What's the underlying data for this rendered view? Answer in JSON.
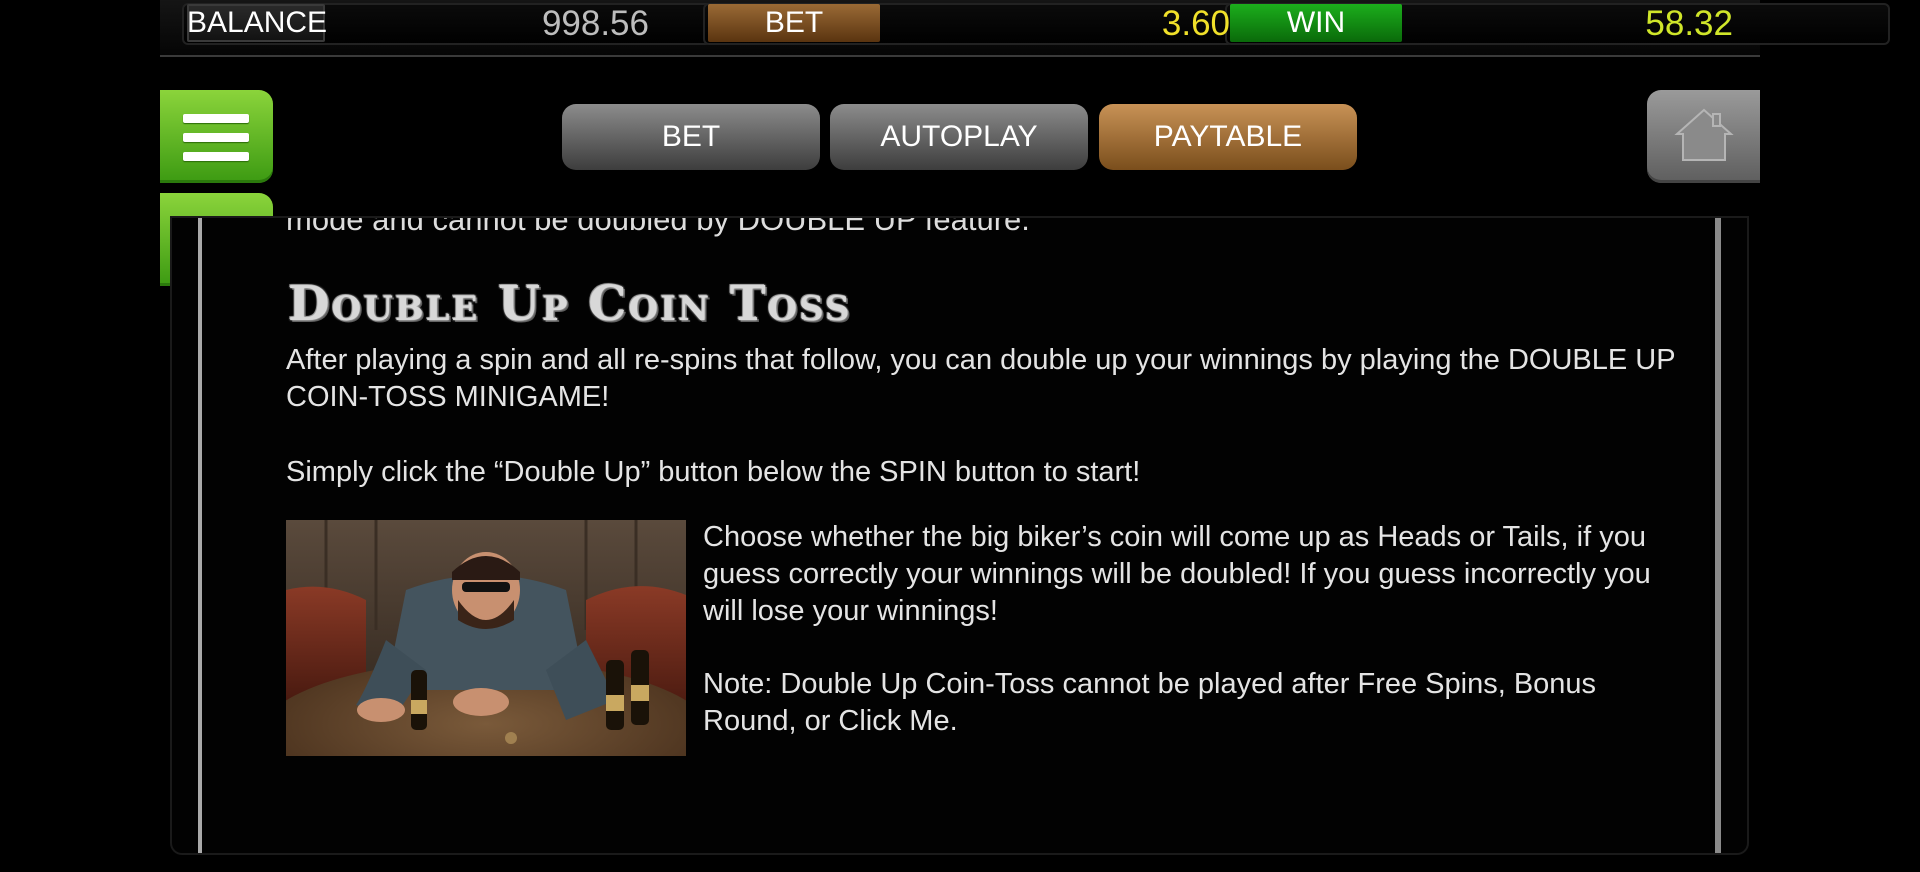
{
  "statusbar": {
    "balance_label": "BALANCE",
    "balance_value": "998.56",
    "bet_label": "BET",
    "bet_value": "3.60",
    "win_label": "WIN",
    "win_value": "58.32"
  },
  "tabs": {
    "bet": "BET",
    "autoplay": "AUTOPLAY",
    "paytable": "PAYTABLE",
    "active": "PAYTABLE"
  },
  "icons": {
    "menu": "hamburger-menu-icon",
    "back": "arrow-left-icon",
    "home": "home-icon"
  },
  "colors": {
    "green_button": "#5cb824",
    "paytable_tab": "#b07a3e",
    "win_label": "#17a017",
    "bet_label": "#8a5a28",
    "bet_value": "#f0e02a",
    "win_value": "#d0e62a"
  },
  "content": {
    "cut_text": "mode and cannot be doubled by DOUBLE UP feature.",
    "heading": "Double Up Coin Toss",
    "para1": "After playing a spin and all re-spins that follow, you can double up your winnings by playing the DOUBLE UP COIN-TOSS MINIGAME!",
    "para2": "Simply click the “Double Up” button below the SPIN button to start!",
    "para3": "Choose whether the big biker’s coin will come up as Heads or Tails, if you guess correctly your winnings will be doubled! If you guess incorrectly you will lose your winnings!",
    "para4": "Note: Double Up Coin-Toss cannot be played after Free Spins, Bonus Round, or Click Me."
  }
}
